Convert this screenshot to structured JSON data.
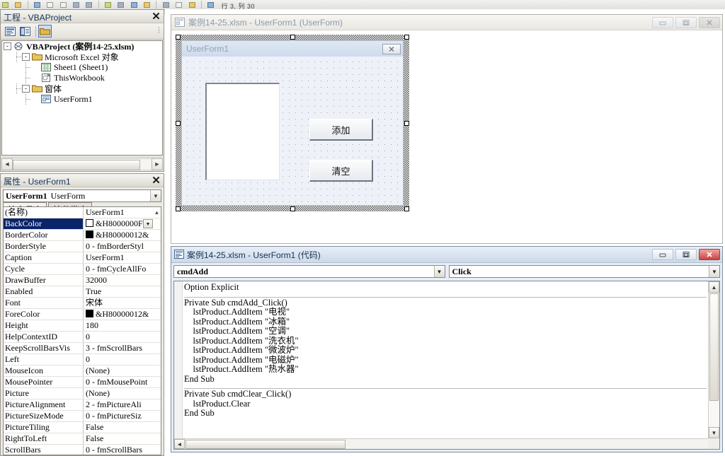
{
  "toolbar": {
    "cell_ref_text": "行 3, 列 30",
    "icons": [
      "excel-icon",
      "save-icon",
      "cut-icon",
      "copy-icon",
      "paste-icon",
      "undo-icon",
      "redo-icon",
      "run-icon",
      "pause-icon",
      "stop-icon",
      "design-mode-icon",
      "project-explorer-icon",
      "properties-window-icon",
      "object-browser-icon",
      "toolbox-icon",
      "help-icon"
    ]
  },
  "project_explorer": {
    "title": "工程 - VBAProject",
    "close_label": "✕",
    "toolbar": {
      "view_code": "查看代码",
      "view_object": "查看对象",
      "toggle_folders": "切换文件夹"
    },
    "tree": [
      {
        "level": 0,
        "expander": "-",
        "icon": "vbaproject-icon",
        "label": "VBAProject (案例14-25.xlsm)",
        "bold": true
      },
      {
        "level": 1,
        "expander": "-",
        "icon": "folder-icon",
        "label": "Microsoft Excel 对象",
        "bold": false
      },
      {
        "level": 2,
        "expander": "",
        "icon": "sheet-icon",
        "label": "Sheet1 (Sheet1)",
        "bold": false
      },
      {
        "level": 2,
        "expander": "",
        "icon": "workbook-icon",
        "label": "ThisWorkbook",
        "bold": false
      },
      {
        "level": 1,
        "expander": "-",
        "icon": "folder-icon",
        "label": "窗体",
        "bold": false
      },
      {
        "level": 2,
        "expander": "",
        "icon": "userform-icon",
        "label": "UserForm1",
        "bold": false
      }
    ]
  },
  "properties_window": {
    "title": "属性 - UserForm1",
    "close_label": "✕",
    "object_name": "UserForm1",
    "object_type": "UserForm",
    "dropdown_arrow": "▼",
    "tabs": [
      {
        "label": "按字母序",
        "active": true
      },
      {
        "label": "按分类序",
        "active": false
      }
    ],
    "rows": [
      {
        "name": "(名称)",
        "value": "UserForm1",
        "swatch": "",
        "dropdown": false,
        "selected": false,
        "scrollup": true
      },
      {
        "name": "BackColor",
        "value": "&H8000000F&",
        "swatch": "#ffffff",
        "dropdown": true,
        "selected": true,
        "scrollup": false
      },
      {
        "name": "BorderColor",
        "value": "&H80000012&",
        "swatch": "#000000",
        "dropdown": false,
        "selected": false,
        "scrollup": false
      },
      {
        "name": "BorderStyle",
        "value": "0 - fmBorderStyl",
        "swatch": "",
        "dropdown": false,
        "selected": false,
        "scrollup": false
      },
      {
        "name": "Caption",
        "value": "UserForm1",
        "swatch": "",
        "dropdown": false,
        "selected": false,
        "scrollup": false
      },
      {
        "name": "Cycle",
        "value": "0 - fmCycleAllFo",
        "swatch": "",
        "dropdown": false,
        "selected": false,
        "scrollup": false
      },
      {
        "name": "DrawBuffer",
        "value": "32000",
        "swatch": "",
        "dropdown": false,
        "selected": false,
        "scrollup": false
      },
      {
        "name": "Enabled",
        "value": "True",
        "swatch": "",
        "dropdown": false,
        "selected": false,
        "scrollup": false
      },
      {
        "name": "Font",
        "value": "宋体",
        "swatch": "",
        "dropdown": false,
        "selected": false,
        "scrollup": false
      },
      {
        "name": "ForeColor",
        "value": "&H80000012&",
        "swatch": "#000000",
        "dropdown": false,
        "selected": false,
        "scrollup": false
      },
      {
        "name": "Height",
        "value": "180",
        "swatch": "",
        "dropdown": false,
        "selected": false,
        "scrollup": false
      },
      {
        "name": "HelpContextID",
        "value": "0",
        "swatch": "",
        "dropdown": false,
        "selected": false,
        "scrollup": false
      },
      {
        "name": "KeepScrollBarsVis",
        "value": "3 - fmScrollBars",
        "swatch": "",
        "dropdown": false,
        "selected": false,
        "scrollup": false
      },
      {
        "name": "Left",
        "value": "0",
        "swatch": "",
        "dropdown": false,
        "selected": false,
        "scrollup": false
      },
      {
        "name": "MouseIcon",
        "value": "(None)",
        "swatch": "",
        "dropdown": false,
        "selected": false,
        "scrollup": false
      },
      {
        "name": "MousePointer",
        "value": "0 - fmMousePoint",
        "swatch": "",
        "dropdown": false,
        "selected": false,
        "scrollup": false
      },
      {
        "name": "Picture",
        "value": "(None)",
        "swatch": "",
        "dropdown": false,
        "selected": false,
        "scrollup": false
      },
      {
        "name": "PictureAlignment",
        "value": "2 - fmPictureAli",
        "swatch": "",
        "dropdown": false,
        "selected": false,
        "scrollup": false
      },
      {
        "name": "PictureSizeMode",
        "value": "0 - fmPictureSiz",
        "swatch": "",
        "dropdown": false,
        "selected": false,
        "scrollup": false
      },
      {
        "name": "PictureTiling",
        "value": "False",
        "swatch": "",
        "dropdown": false,
        "selected": false,
        "scrollup": false
      },
      {
        "name": "RightToLeft",
        "value": "False",
        "swatch": "",
        "dropdown": false,
        "selected": false,
        "scrollup": false
      },
      {
        "name": "ScrollBars",
        "value": "0 - fmScrollBars",
        "swatch": "",
        "dropdown": false,
        "selected": false,
        "scrollup": false
      }
    ]
  },
  "designer_window": {
    "title": "案例14-25.xlsm - UserForm1 (UserForm)",
    "active": false,
    "buttons": {
      "minimize": "—",
      "restore": "❐",
      "close": "✕"
    },
    "form": {
      "caption": "UserForm1",
      "close_label": "✕",
      "listbox_name": "lstProduct",
      "controls": [
        {
          "name": "cmdAdd",
          "label": "添加"
        },
        {
          "name": "cmdClear",
          "label": "清空"
        }
      ]
    }
  },
  "code_window": {
    "title": "案例14-25.xlsm - UserForm1 (代码)",
    "active": true,
    "buttons": {
      "minimize": "—",
      "restore": "❐",
      "close": "✕"
    },
    "object_combo": "cmdAdd",
    "procedure_combo": "Click",
    "dropdown_arrow": "▼",
    "code_block_1": "Option Explicit",
    "code_block_2": "Private Sub cmdAdd_Click()\n    lstProduct.AddItem \"电视\"\n    lstProduct.AddItem \"冰箱\"\n    lstProduct.AddItem \"空调\"\n    lstProduct.AddItem \"洗衣机\"\n    lstProduct.AddItem \"微波炉\"\n    lstProduct.AddItem \"电磁炉\"\n    lstProduct.AddItem \"热水器\"\nEnd Sub",
    "code_block_3": "Private Sub cmdClear_Click()\n    lstProduct.Clear\nEnd Sub"
  },
  "colors": {
    "accent": "#0a246a",
    "close_red": "#c9443e",
    "panel_bg": "#eceae4",
    "form_bg": "#eef1f7"
  }
}
